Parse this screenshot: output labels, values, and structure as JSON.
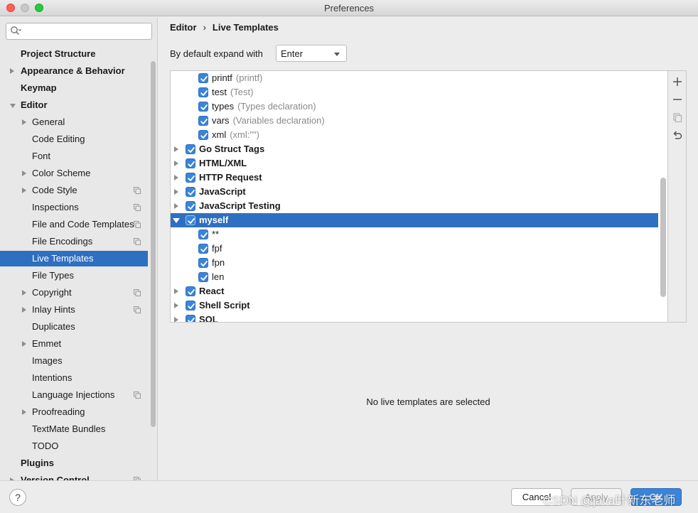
{
  "window": {
    "title": "Preferences"
  },
  "search": {
    "placeholder": ""
  },
  "sidebar": {
    "items": [
      {
        "label": "Project Structure",
        "level": 0,
        "arrow": "none",
        "copy_icon": false,
        "selected": false
      },
      {
        "label": "Appearance & Behavior",
        "level": 0,
        "arrow": "right",
        "copy_icon": false,
        "selected": false
      },
      {
        "label": "Keymap",
        "level": 0,
        "arrow": "none",
        "copy_icon": false,
        "selected": false
      },
      {
        "label": "Editor",
        "level": 0,
        "arrow": "down",
        "copy_icon": false,
        "selected": false
      },
      {
        "label": "General",
        "level": 1,
        "arrow": "right",
        "copy_icon": false,
        "selected": false
      },
      {
        "label": "Code Editing",
        "level": 1,
        "arrow": "none",
        "copy_icon": false,
        "selected": false
      },
      {
        "label": "Font",
        "level": 1,
        "arrow": "none",
        "copy_icon": false,
        "selected": false
      },
      {
        "label": "Color Scheme",
        "level": 1,
        "arrow": "right",
        "copy_icon": false,
        "selected": false
      },
      {
        "label": "Code Style",
        "level": 1,
        "arrow": "right",
        "copy_icon": true,
        "selected": false
      },
      {
        "label": "Inspections",
        "level": 1,
        "arrow": "none",
        "copy_icon": true,
        "selected": false
      },
      {
        "label": "File and Code Templates",
        "level": 1,
        "arrow": "none",
        "copy_icon": true,
        "selected": false
      },
      {
        "label": "File Encodings",
        "level": 1,
        "arrow": "none",
        "copy_icon": true,
        "selected": false
      },
      {
        "label": "Live Templates",
        "level": 1,
        "arrow": "none",
        "copy_icon": false,
        "selected": true
      },
      {
        "label": "File Types",
        "level": 1,
        "arrow": "none",
        "copy_icon": false,
        "selected": false
      },
      {
        "label": "Copyright",
        "level": 1,
        "arrow": "right",
        "copy_icon": true,
        "selected": false
      },
      {
        "label": "Inlay Hints",
        "level": 1,
        "arrow": "right",
        "copy_icon": true,
        "selected": false
      },
      {
        "label": "Duplicates",
        "level": 1,
        "arrow": "none",
        "copy_icon": false,
        "selected": false
      },
      {
        "label": "Emmet",
        "level": 1,
        "arrow": "right",
        "copy_icon": false,
        "selected": false
      },
      {
        "label": "Images",
        "level": 1,
        "arrow": "none",
        "copy_icon": false,
        "selected": false
      },
      {
        "label": "Intentions",
        "level": 1,
        "arrow": "none",
        "copy_icon": false,
        "selected": false
      },
      {
        "label": "Language Injections",
        "level": 1,
        "arrow": "none",
        "copy_icon": true,
        "selected": false
      },
      {
        "label": "Proofreading",
        "level": 1,
        "arrow": "right",
        "copy_icon": false,
        "selected": false
      },
      {
        "label": "TextMate Bundles",
        "level": 1,
        "arrow": "none",
        "copy_icon": false,
        "selected": false
      },
      {
        "label": "TODO",
        "level": 1,
        "arrow": "none",
        "copy_icon": false,
        "selected": false
      },
      {
        "label": "Plugins",
        "level": 0,
        "arrow": "none",
        "copy_icon": false,
        "selected": false
      },
      {
        "label": "Version Control",
        "level": 0,
        "arrow": "right",
        "copy_icon": true,
        "selected": false
      }
    ]
  },
  "breadcrumb": {
    "parent": "Editor",
    "separator": "›",
    "current": "Live Templates"
  },
  "expand": {
    "label": "By default expand with",
    "value": "Enter"
  },
  "tree": {
    "rows": [
      {
        "kind": "child",
        "name": "printf",
        "desc": "(printf)",
        "checked": true
      },
      {
        "kind": "child",
        "name": "test",
        "desc": "(Test)",
        "checked": true
      },
      {
        "kind": "child",
        "name": "types",
        "desc": "(Types declaration)",
        "checked": true
      },
      {
        "kind": "child",
        "name": "vars",
        "desc": "(Variables declaration)",
        "checked": true
      },
      {
        "kind": "child",
        "name": "xml",
        "desc": "(xml:\"\")",
        "checked": true
      },
      {
        "kind": "group",
        "name": "Go Struct Tags",
        "desc": "",
        "checked": true,
        "expanded": false
      },
      {
        "kind": "group",
        "name": "HTML/XML",
        "desc": "",
        "checked": true,
        "expanded": false
      },
      {
        "kind": "group",
        "name": "HTTP Request",
        "desc": "",
        "checked": true,
        "expanded": false
      },
      {
        "kind": "group",
        "name": "JavaScript",
        "desc": "",
        "checked": true,
        "expanded": false
      },
      {
        "kind": "group",
        "name": "JavaScript Testing",
        "desc": "",
        "checked": true,
        "expanded": false
      },
      {
        "kind": "group",
        "name": "myself",
        "desc": "",
        "checked": true,
        "expanded": true,
        "selected": true
      },
      {
        "kind": "child",
        "name": "**",
        "desc": "",
        "checked": true
      },
      {
        "kind": "child",
        "name": "fpf",
        "desc": "",
        "checked": true
      },
      {
        "kind": "child",
        "name": "fpn",
        "desc": "",
        "checked": true
      },
      {
        "kind": "child",
        "name": "len",
        "desc": "",
        "checked": true
      },
      {
        "kind": "group",
        "name": "React",
        "desc": "",
        "checked": true,
        "expanded": false
      },
      {
        "kind": "group",
        "name": "Shell Script",
        "desc": "",
        "checked": true,
        "expanded": false
      },
      {
        "kind": "group",
        "name": "SQL",
        "desc": "",
        "checked": true,
        "expanded": false
      }
    ]
  },
  "tools": {
    "add": "+",
    "remove": "−"
  },
  "empty_message": "No live templates are selected",
  "buttons": {
    "help": "?",
    "cancel": "Cancel",
    "apply": "Apply",
    "ok": "OK"
  },
  "watermark": "CSDN @java叶新东老师",
  "colors": {
    "accent": "#2f6fc1",
    "checkbox": "#3b84d8"
  }
}
